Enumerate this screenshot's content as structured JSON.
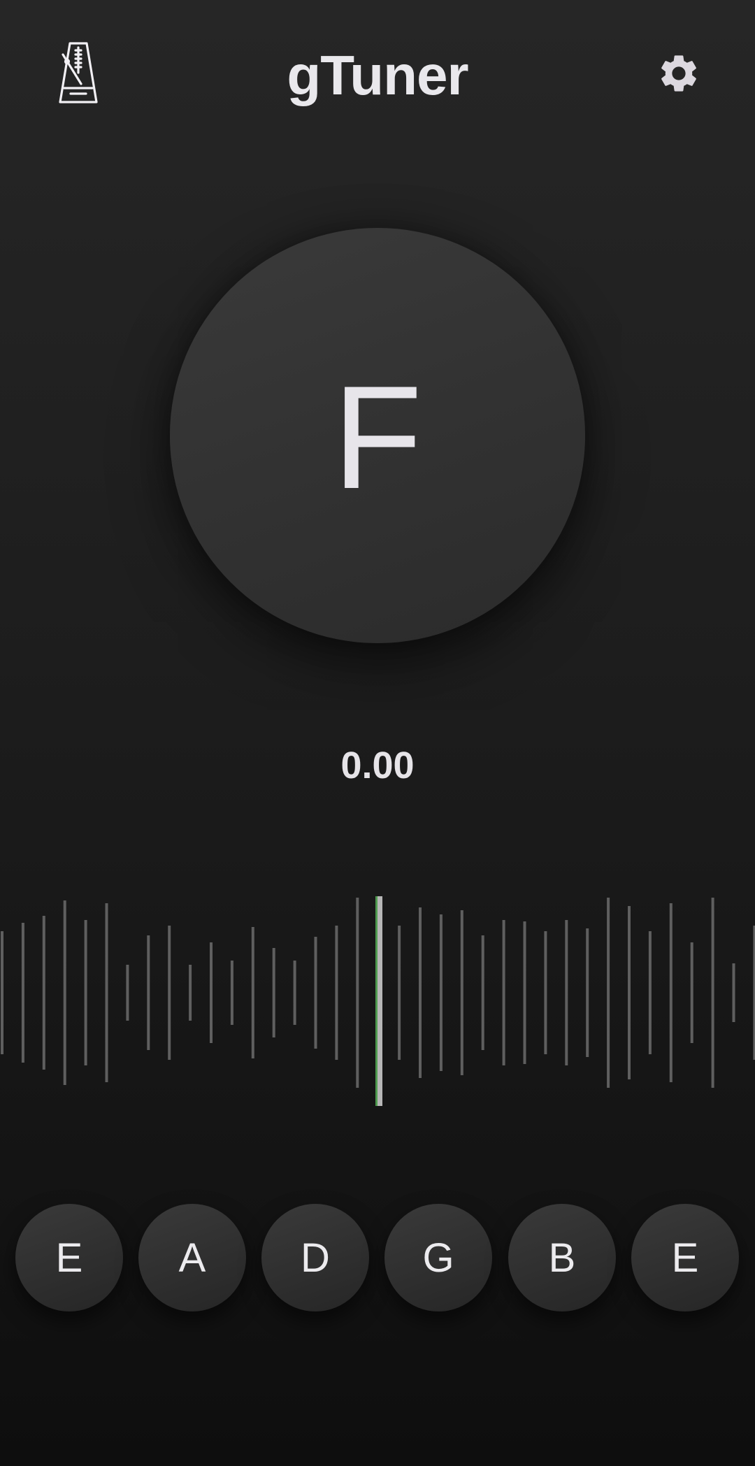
{
  "header": {
    "title": "gTuner",
    "left_icon": "metronome-icon",
    "right_icon": "gear-icon"
  },
  "tuner": {
    "note": "F",
    "frequency": "0.00"
  },
  "strings": {
    "items": [
      {
        "label": "E"
      },
      {
        "label": "A"
      },
      {
        "label": "D"
      },
      {
        "label": "G"
      },
      {
        "label": "B"
      },
      {
        "label": "E"
      }
    ]
  },
  "colors": {
    "background_top": "#262626",
    "background_bottom": "#0e0e0e",
    "text": "#ecebee",
    "meter_tick": "#5f5f5f",
    "needle": "#b7b7b7",
    "needle_accent": "#4f9a4f",
    "icon": "#dcd8df"
  }
}
